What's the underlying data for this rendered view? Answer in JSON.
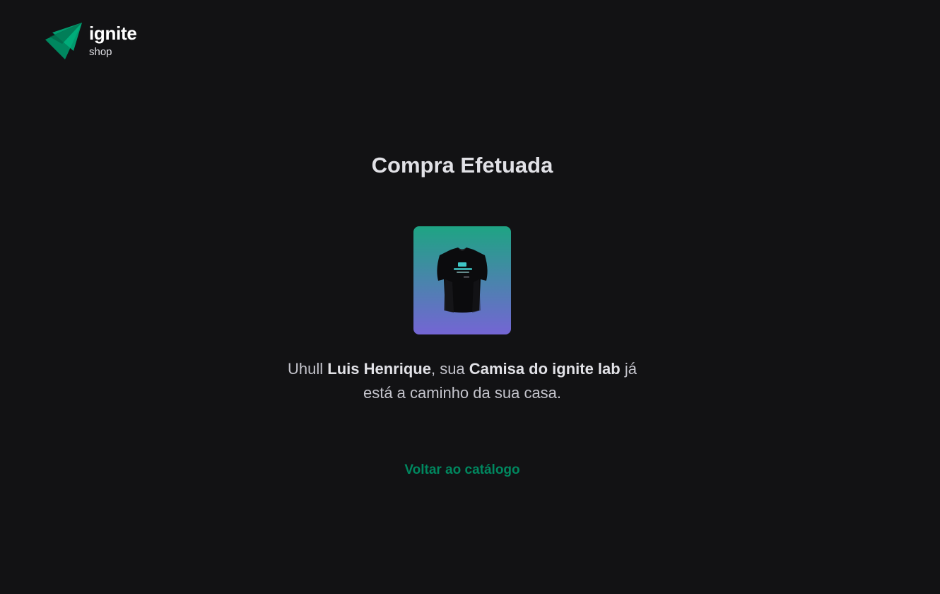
{
  "header": {
    "logo_icon": "ignite-logo-icon",
    "logo_word": "ignite",
    "logo_sub": "shop"
  },
  "success": {
    "title": "Compra Efetuada",
    "product_image_icon": "tshirt-icon",
    "message": {
      "prefix": "Uhull ",
      "customer_name": "Luis Henrique",
      "middle": ", sua ",
      "product_name": "Camisa do ignite lab",
      "suffix": " já está a caminho da sua casa."
    },
    "back_link": "Voltar ao catálogo"
  },
  "colors": {
    "background": "#121214",
    "text": "#e1e1e6",
    "accent": "#00875f",
    "gradient_top": "#1ea483",
    "gradient_bottom": "#7465d4"
  }
}
